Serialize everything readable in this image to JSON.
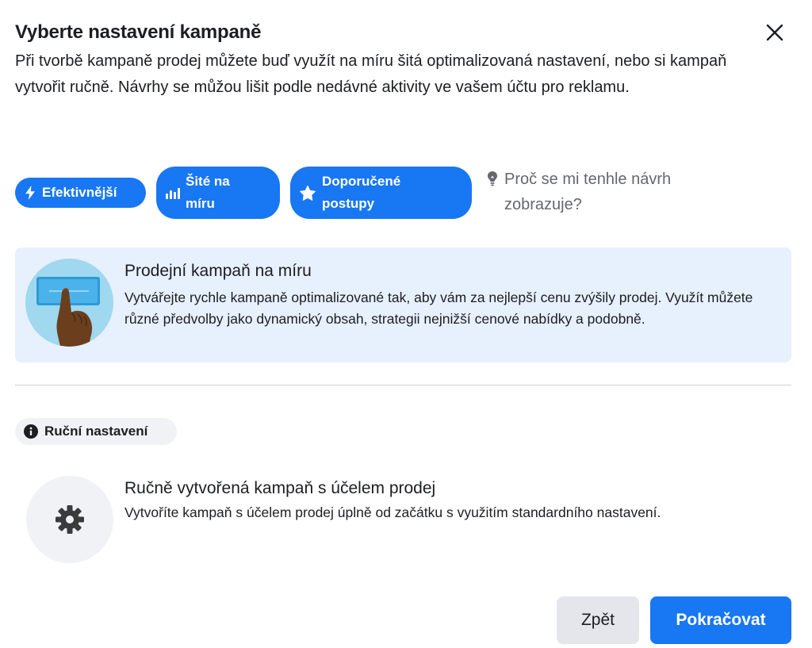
{
  "dialog": {
    "title": "Vyberte nastavení kampaně",
    "description": "Při tvorbě kampaně prodej můžete buď využít na míru šitá optimalizovaná nastavení, nebo si kampaň vytvořit ručně. Návrhy se můžou lišit podle nedávné aktivity ve vašem účtu pro reklamu.",
    "close_icon": "close-icon"
  },
  "chips": [
    {
      "label": "Efektivnější",
      "icon": "lightning-icon"
    },
    {
      "label": "Šité na míru",
      "icon": "bar-chart-icon"
    },
    {
      "label": "Doporučené postupy",
      "icon": "star-icon"
    }
  ],
  "why_link": {
    "text": "Proč se mi tenhle návrh zobrazuje?",
    "icon": "lightbulb-icon"
  },
  "recommended": {
    "title": "Prodejní kampaň na míru",
    "description": "Vytvářejte rychle kampaně optimalizované tak, aby vám za nejlepší cenu zvýšily prodej. Využít můžete různé předvolby jako dynamický obsah, strategii nejnižší cenové nabídky a podobně.",
    "illustration": "hand-tapping-button-illustration"
  },
  "manual_badge": {
    "label": "Ruční nastavení",
    "icon": "info-icon"
  },
  "manual": {
    "title": "Ručně vytvořená kampaň s účelem prodej",
    "description": "Vytvoříte kampaň s účelem prodej úplně od začátku s využitím standardního nastavení.",
    "icon": "gear-icon"
  },
  "buttons": {
    "back": "Zpět",
    "next": "Pokračovat"
  },
  "colors": {
    "primary": "#1877f2",
    "card_bg": "#e7f0fd",
    "muted_bg": "#f0f2f5",
    "secondary_text": "#65676b"
  }
}
